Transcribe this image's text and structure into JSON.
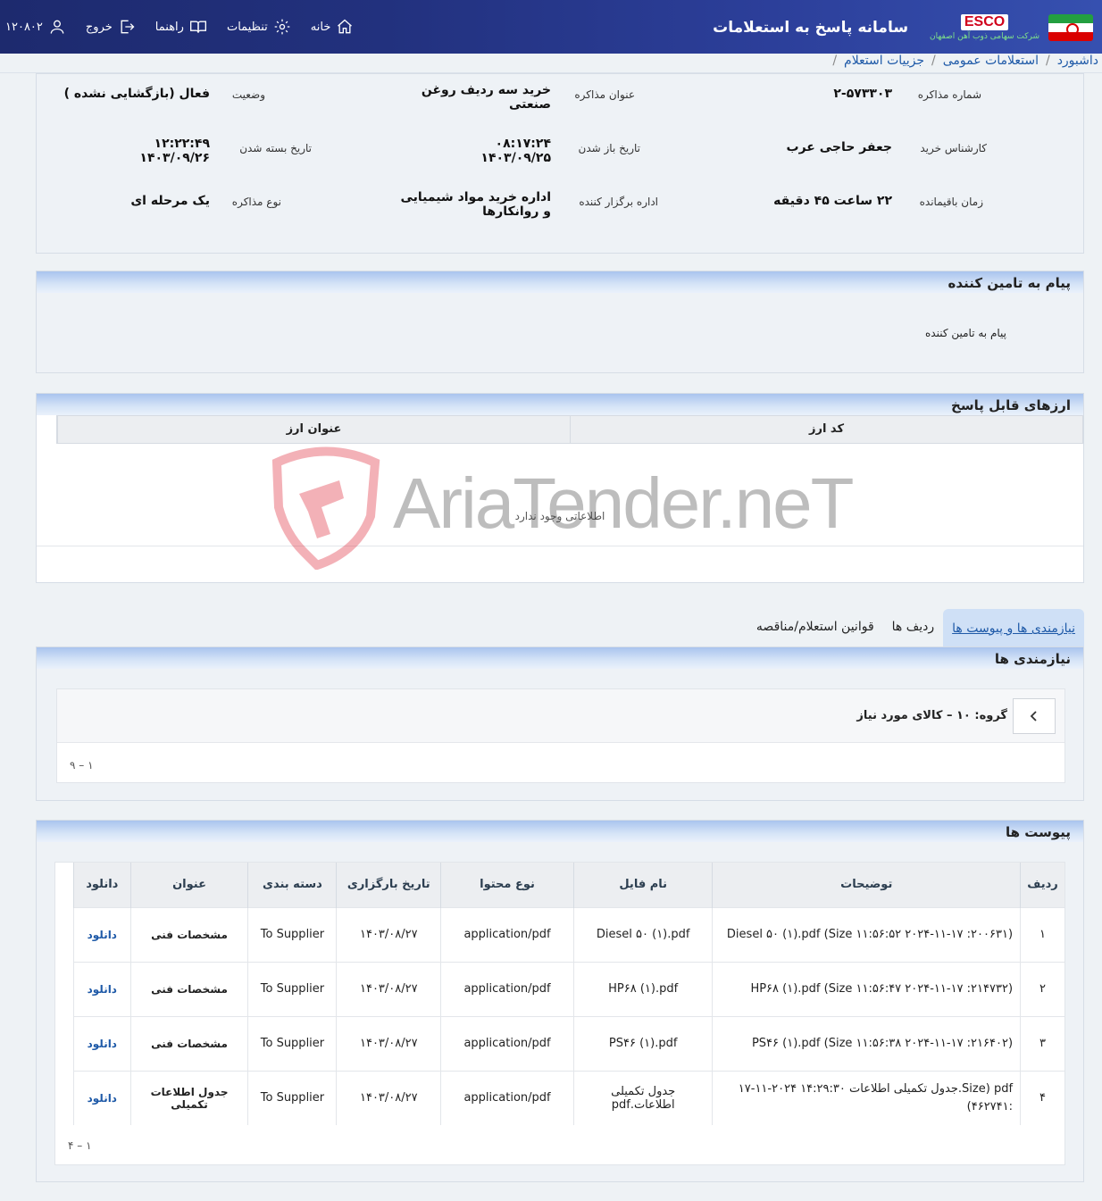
{
  "header": {
    "system_title": "سامانه پاسخ به استعلامات",
    "logo_text": "ESCO",
    "logo_sub": "شرکت سهامی ذوب آهن اصفهان",
    "nav": {
      "home": "خانه",
      "settings": "تنظیمات",
      "guide": "راهنما",
      "logout": "خروج",
      "user_id": "۱۲۰۸۰۲"
    }
  },
  "breadcrumb": [
    "داشبورد",
    "استعلامات عمومی",
    "جزییات استعلام"
  ],
  "info": {
    "neg_number_label": "شماره مذاکره",
    "neg_number": "۲-۵۷۳۳۰۳",
    "title_label": "عنوان مذاکره",
    "title": "خرید سه ردیف روغن صنعتی",
    "status_label": "وضعیت",
    "status": "فعال (بازگشایی نشده )",
    "expert_label": "کارشناس خرید",
    "expert": "جعفر حاجی عرب",
    "open_date_label": "تاریخ باز شدن",
    "open_date": "۰۸:۱۷:۲۴ ۱۴۰۳/۰۹/۲۵",
    "close_date_label": "تاریخ بسته شدن",
    "close_date": "۱۲:۲۲:۴۹ ۱۴۰۳/۰۹/۲۶",
    "remaining_label": "زمان باقیمانده",
    "remaining": "۲۲ ساعت ۴۵ دقیقه",
    "organizer_label": "اداره برگزار کننده",
    "organizer": "اداره خرید مواد شیمیایی و روانکارها",
    "neg_type_label": "نوع مذاکره",
    "neg_type": "یک مرحله ای"
  },
  "message": {
    "heading": "پیام به تامین کننده",
    "body": "پیام به تامین کننده"
  },
  "currencies": {
    "heading": "ارزهای قابل پاسخ",
    "col_code": "کد ارز",
    "col_title": "عنوان ارز",
    "empty": "اطلاعاتی وجود ندارد"
  },
  "watermark": "AriaTender.neT",
  "tabs": [
    "نیازمندی ها و پیوست ها",
    "ردیف ها",
    "قوانین استعلام/مناقصه"
  ],
  "needs": {
    "heading": "نیازمندی ها",
    "group": "گروه: ۱۰ – کالای مورد نیاز",
    "pager": "۱ – ۹"
  },
  "attachments": {
    "heading": "پیوست ها",
    "columns": [
      "ردیف",
      "توضیحات",
      "نام فایل",
      "نوع محتوا",
      "تاریخ بارگزاری",
      "دسته بندی",
      "عنوان",
      "دانلود"
    ],
    "rows": [
      {
        "idx": "۱",
        "desc": "Diesel ۵۰ (۱).pdf (Size ۱۱:۵۶:۵۲ ۲۰۲۴-۱۱-۱۷ :۲۰۰۶۳۱)",
        "file": "Diesel ۵۰ (۱).pdf",
        "type": "application/pdf",
        "date": "۱۴۰۳/۰۸/۲۷",
        "cat": "To Supplier",
        "title": "مشخصات فنی",
        "dl": "دانلود"
      },
      {
        "idx": "۲",
        "desc": "HP۶۸ (۱).pdf (Size ۱۱:۵۶:۴۷ ۲۰۲۴-۱۱-۱۷ :۲۱۴۷۳۲)",
        "file": "HP۶۸ (۱).pdf",
        "type": "application/pdf",
        "date": "۱۴۰۳/۰۸/۲۷",
        "cat": "To Supplier",
        "title": "مشخصات فنی",
        "dl": "دانلود"
      },
      {
        "idx": "۳",
        "desc": "PS۴۶ (۱).pdf (Size ۱۱:۵۶:۳۸ ۲۰۲۴-۱۱-۱۷ :۲۱۶۴۰۲)",
        "file": "PS۴۶ (۱).pdf",
        "type": "application/pdf",
        "date": "۱۴۰۳/۰۸/۲۷",
        "cat": "To Supplier",
        "title": "مشخصات فنی",
        "dl": "دانلود"
      },
      {
        "idx": "۴",
        "desc": "pdf (Size.جدول تکمیلی اطلاعات ۱۴:۲۹:۳۰ ۲۰۲۴-۱۱-۱۷ :۴۶۲۷۴۱)",
        "file": "جدول تکمیلی اطلاعات.pdf",
        "type": "application/pdf",
        "date": "۱۴۰۳/۰۸/۲۷",
        "cat": "To Supplier",
        "title": "جدول اطلاعات تکمیلی",
        "dl": "دانلود"
      }
    ],
    "pager": "۱ – ۴"
  }
}
